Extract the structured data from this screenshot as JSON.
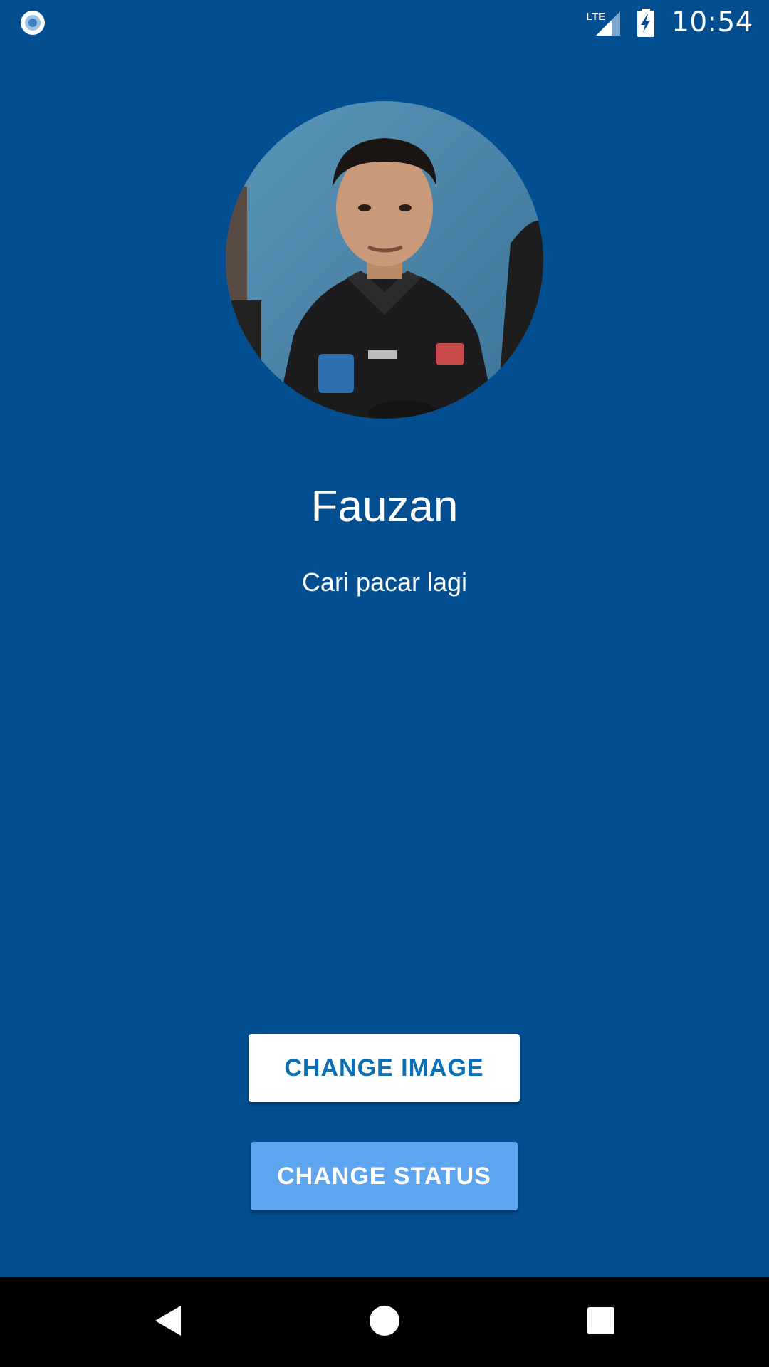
{
  "status_bar": {
    "time": "10:54",
    "left_icon": "record-circle-icon",
    "network_label": "LTE",
    "network_icon": "signal-lte-icon",
    "battery_icon": "battery-charging-icon"
  },
  "profile": {
    "avatar_icon": "profile-photo",
    "name": "Fauzan",
    "status": "Cari pacar lagi"
  },
  "actions": {
    "change_image_label": "CHANGE IMAGE",
    "change_status_label": "CHANGE STATUS"
  },
  "navigation": {
    "back_icon": "back-triangle-icon",
    "home_icon": "home-circle-icon",
    "recents_icon": "recents-square-icon"
  },
  "colors": {
    "background": "#024E91",
    "primary_button_bg": "#FFFFFF",
    "primary_button_text": "#0A6FB5",
    "secondary_button_bg": "#5EA5EF",
    "secondary_button_text": "#FFFFFF",
    "nav_bar": "#000000"
  }
}
